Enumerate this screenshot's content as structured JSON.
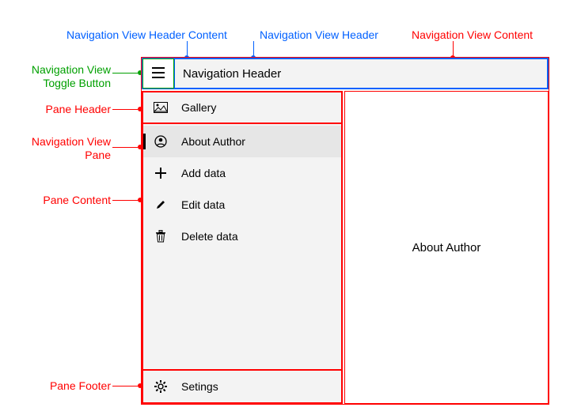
{
  "labels": {
    "toggle": "Navigation View\nToggle Button",
    "headerContent": "Navigation View Header Content",
    "header": "Navigation View Header",
    "content": "Navigation View Content",
    "paneHeader": "Pane Header",
    "pane": "Navigation View\nPane",
    "paneContent": "Pane Content",
    "paneFooter": "Pane Footer"
  },
  "header": {
    "title": "Navigation Header"
  },
  "paneHeader": {
    "label": "Gallery"
  },
  "paneItems": [
    {
      "label": "About Author",
      "icon": "user-circle",
      "selected": true
    },
    {
      "label": "Add data",
      "icon": "plus",
      "selected": false
    },
    {
      "label": "Edit data",
      "icon": "pencil",
      "selected": false
    },
    {
      "label": "Delete data",
      "icon": "trash",
      "selected": false
    }
  ],
  "paneFooter": {
    "label": "Setings"
  },
  "contentArea": {
    "text": "About Author"
  }
}
